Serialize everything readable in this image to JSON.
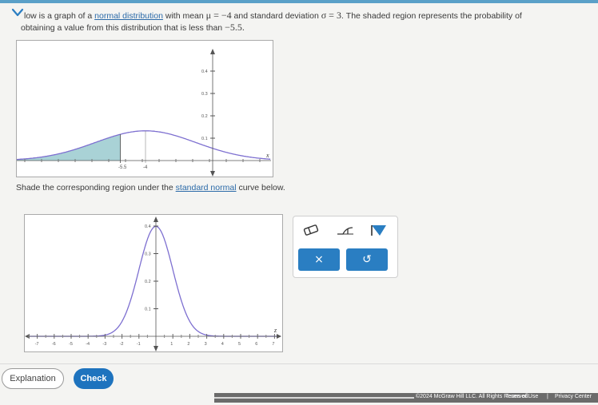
{
  "question": {
    "prefix": "low is a graph of a",
    "link1": "normal distribution",
    "mid1": "with mean",
    "mean_expr": "μ = −4",
    "mid2": "and standard deviation",
    "sd_expr": "σ = 3",
    "suffix": ". The shaded region represents the probability of",
    "line2_text": "obtaining a value from this distribution that is less than",
    "line2_value": "−5.5."
  },
  "graph1": {
    "y_ticks": [
      "0.4",
      "0.3",
      "0.2",
      "0.1"
    ],
    "x_axis_label": "x",
    "x_labels": [
      "-5.5",
      "-4"
    ],
    "mean": -4,
    "sd": 3,
    "shade_upper": -5.5
  },
  "instruction": {
    "prefix": "Shade the corresponding region under the",
    "link": "standard normal",
    "suffix": "curve below."
  },
  "graph2": {
    "y_ticks": [
      "0.4",
      "0.3",
      "0.2",
      "0.1"
    ],
    "x_axis_label": "z",
    "x_labels": [
      "-7",
      "-6",
      "-5",
      "-4",
      "-3",
      "-2",
      "-1",
      "1",
      "2",
      "3",
      "4",
      "5",
      "6",
      "7"
    ],
    "mean": 0,
    "sd": 1
  },
  "tools": {
    "eraser_icon": "eraser-icon",
    "one_sided_icon": "one-sided-region-icon",
    "shade_icon": "shade-fill-icon",
    "clear_label": "×",
    "undo_label": "↺"
  },
  "actions": {
    "explanation_label": "Explanation",
    "check_label": "Check"
  },
  "footer": {
    "copyright": "©2024 McGraw Hill LLC. All Rights Reserved.",
    "terms": "Terms of Use",
    "separator": "|",
    "privacy": "Privacy Center"
  },
  "colors": {
    "accent": "#2a7ec2",
    "curve": "#7d6fd0",
    "shade": "#a9d2d6",
    "link": "#2b6aa8"
  }
}
